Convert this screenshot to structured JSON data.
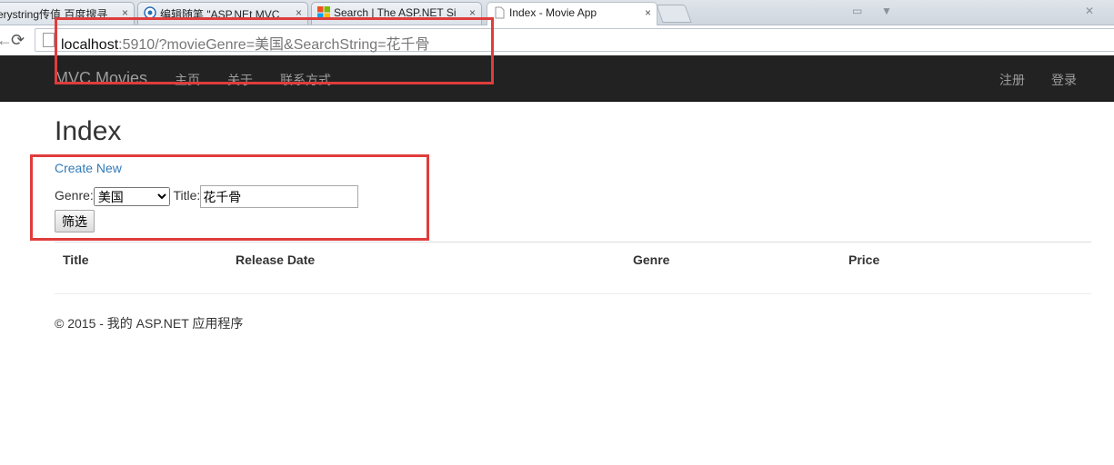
{
  "browser": {
    "tabs": [
      {
        "title": "erystring传值 百度搜寻",
        "icon": "none",
        "active": false
      },
      {
        "title": "编辑随笔 \"ASP.NEt MVC",
        "icon": "blog-icon",
        "active": false
      },
      {
        "title": "Search | The ASP.NET Si",
        "icon": "windows-logo-icon",
        "active": false
      },
      {
        "title": "Index - Movie App",
        "icon": "page-icon",
        "active": true
      }
    ],
    "close_glyph": "×",
    "address": {
      "host": "localhost",
      "rest": ":5910/?movieGenre=美国&SearchString=花千骨"
    }
  },
  "navbar": {
    "brand": "MVC Movies",
    "links": [
      "主页",
      "关于",
      "联系方式"
    ],
    "right_links": [
      "注册",
      "登录"
    ]
  },
  "page": {
    "heading": "Index",
    "create_new": "Create New",
    "filter": {
      "genre_label": "Genre:",
      "genre_selected": "美国",
      "title_label": "Title:",
      "title_value": "花千骨",
      "submit_label": "筛选"
    },
    "table": {
      "headers": [
        "Title",
        "Release Date",
        "Genre",
        "Price"
      ]
    },
    "footer": "© 2015 - 我的 ASP.NET 应用程序"
  },
  "colors": {
    "navbar_bg": "#222222",
    "link": "#337ab7",
    "annotation": "#e03c3c"
  }
}
